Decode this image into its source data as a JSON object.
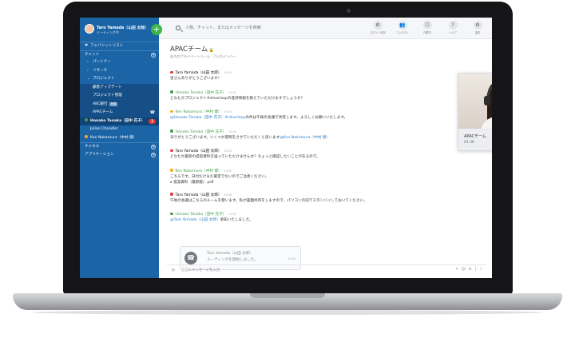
{
  "sidebar": {
    "user_name": "Taro Yamada（山田 太郎）",
    "user_status": "ミーティング中",
    "add_symbol": "+",
    "favorites_label": "フェバリットリスト",
    "chat_label": "チャット",
    "items": [
      {
        "label": "パートナー"
      },
      {
        "label": "リサーチ"
      },
      {
        "label": "プロジェクト"
      },
      {
        "label": "顧客アップデート"
      },
      {
        "label": "プロジェクト管理"
      },
      {
        "label": "ABC銀行",
        "tag": "外部"
      },
      {
        "label": "APACチーム"
      },
      {
        "label": "Hanako Tanaka（田中 花子）",
        "badge": "1"
      },
      {
        "label": "Julian Chandler"
      },
      {
        "label": "Ken Nakamura（中村 健）"
      }
    ],
    "channels_label": "チャネル",
    "apps_label": "アプリケーション"
  },
  "topbar": {
    "search_placeholder": "人物、チャット、またはメッセージを検索",
    "tools": [
      {
        "label": "ログイン状況",
        "icon": "⚙"
      },
      {
        "label": "コンタクト",
        "icon": "👥"
      },
      {
        "label": "作業中",
        "icon": "☐"
      },
      {
        "label": "ヘルプ",
        "icon": "?"
      },
      {
        "label": "設定",
        "icon": "⚙"
      }
    ]
  },
  "room": {
    "title": "APACチーム",
    "subtitle": "社内のプライベートルーム｜7人のメンバー"
  },
  "messages": [
    {
      "name": "Taro Yamada（山田 太郎）",
      "time": "14:50",
      "color": "#e53935",
      "body": "皆さんありがとうございます！"
    },
    {
      "name": "Hanako Tanaka（田中 花子）",
      "time": "14:51",
      "color": "#43a047",
      "body": "どなたかプロジェクト#silverloopの進捗情報を教えていただけますでしょうか？"
    },
    {
      "name": "Ken Nakamura（中村 健）",
      "time": "14:52",
      "color": "#f9a825",
      "mention1": "@Hanako Tanaka（田中 花子）#silverloop",
      "body": "の件は午後の会議で共有します。よろしくお願いいたします。"
    },
    {
      "name": "Hanako Tanaka（田中 花子）",
      "time": "14:53",
      "color": "#43a047",
      "body": "ありがとうございます。いくつか質問をさせていただくと思います",
      "mention2": "@Ken Nakamura（中村 健）"
    },
    {
      "name": "Taro Yamada（山田 太郎）",
      "time": "14:54",
      "color": "#e53935",
      "body": "どなたか最新の提案資料を送っていただけませんか？ちょっと確認したいことがあるので。"
    },
    {
      "name": "Ken Nakamura（中村 健）",
      "time": "14:55",
      "color": "#f9a825",
      "body": "こちらです。日付だけまだ確定でないのでご注意ください。",
      "attachment": "提案資料（最新版）.pdf"
    },
    {
      "name": "Taro Yamada（山田 太郎）",
      "time": "14:56",
      "color": "#e53935",
      "body": "午後の会議はこちらのルームを使います。私が画面共有をしますので、パソコンの前でスタンバイしておいてください。"
    },
    {
      "name": "Hanako Tanaka（田中 花子）",
      "time": "14:57",
      "color": "#43a047",
      "mention1": "@Taro Yamada（山田 太郎）",
      "body": "承知いたしました。"
    }
  ],
  "call_card": {
    "name": "Taro Yamada（山田 太郎）",
    "body": "ミーティングを開始しました。",
    "time": "15:00"
  },
  "composer": {
    "placeholder": "ここにメッセージを入力",
    "add_symbol": "+",
    "icons": "⚭ ☺ ⊘ │ ♪"
  },
  "video": {
    "name": "APACチーム",
    "time": "01:36",
    "mic_symbol": "🎤",
    "hangup_symbol": "☎"
  }
}
